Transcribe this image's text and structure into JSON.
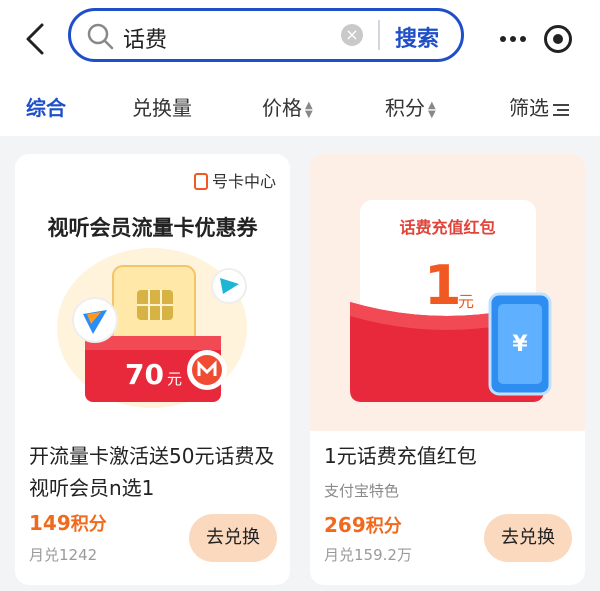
{
  "search": {
    "query": "话费",
    "button_label": "搜索"
  },
  "filters": [
    {
      "label": "综合",
      "active": true
    },
    {
      "label": "兑换量",
      "active": false
    },
    {
      "label": "价格",
      "active": false
    },
    {
      "label": "积分",
      "active": false
    },
    {
      "label": "筛选",
      "active": false
    }
  ],
  "cards": [
    {
      "tag": "号卡中心",
      "coupon_heading": "视听会员流量卡优惠券",
      "art_amount": "70",
      "art_unit": "元",
      "title": "开流量卡激活送50元话费及视听会员n选1",
      "points": "149",
      "points_unit": "积分",
      "sold": "月兑1242",
      "button_label": "去兑换"
    },
    {
      "banner_title": "话费充值红包",
      "art_amount": "1",
      "art_unit": "元",
      "title": "1元话费充值红包",
      "subtitle": "支付宝特色",
      "points": "269",
      "points_unit": "积分",
      "sold": "月兑159.2万",
      "button_label": "去兑换"
    }
  ],
  "colors": {
    "accent": "#1f4fc8",
    "price": "#f06a1e",
    "button": "#fbd9bf"
  },
  "icons": [
    "back-arrow-icon",
    "search-icon",
    "clear-icon",
    "more-icon",
    "target-icon",
    "sort-arrows-icon",
    "filter-lines-icon",
    "sim-card-icon"
  ]
}
